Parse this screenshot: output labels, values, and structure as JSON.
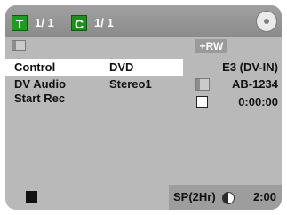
{
  "header": {
    "title_badge": "T",
    "title_counter": "1/ 1",
    "chapter_badge": "C",
    "chapter_counter": "1/ 1",
    "title_badge_color": "#18a018",
    "chapter_badge_color": "#1f8e1f",
    "disc_icon": "disc-icon"
  },
  "media": {
    "format_label": "+RW"
  },
  "settings": {
    "rows": [
      {
        "label": "Control",
        "value": "DVD",
        "selected": true
      },
      {
        "label": "DV Audio",
        "value": "Stereo1",
        "selected": false
      },
      {
        "label": "Start Rec",
        "value": "",
        "selected": false
      }
    ]
  },
  "info": {
    "input_name": "E3 (DV-IN)",
    "tape_id": "AB-1234",
    "time_code": "0:00:00"
  },
  "status": {
    "record_mode": "SP(2Hr)",
    "remaining_time": "2:00",
    "stop_icon": "stop-icon",
    "timer_icon": "half-pie-icon"
  }
}
